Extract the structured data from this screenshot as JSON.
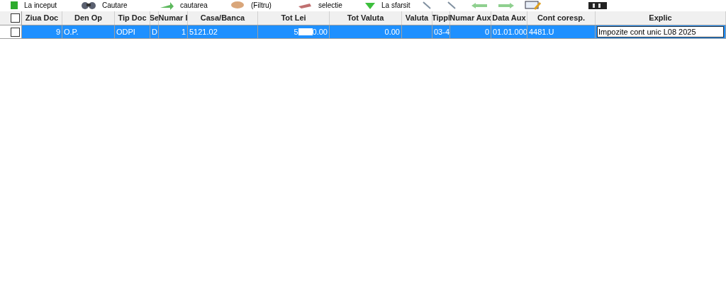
{
  "toolbar": [
    {
      "kind": "first",
      "label": "La inceput"
    },
    {
      "kind": "search",
      "label": "Cautare"
    },
    {
      "kind": "next",
      "label": "cautarea"
    },
    {
      "kind": "filter",
      "label": "(Filtru)"
    },
    {
      "kind": "select",
      "label": "selectie"
    },
    {
      "kind": "last",
      "label": "La sfarsit"
    },
    {
      "kind": "zoom"
    },
    {
      "kind": "zoom"
    },
    {
      "kind": "left"
    },
    {
      "kind": "right"
    },
    {
      "kind": "edit"
    },
    {
      "kind": "print"
    }
  ],
  "table": {
    "columns": [
      "Ziua Doc",
      "Den Op",
      "Tip Doc",
      "Se",
      "Numar I",
      "Casa/Banca",
      "Tot Lei",
      "Tot Valuta",
      "Valuta",
      "Tippl",
      "Numar Aux",
      "Data Aux",
      "Cont coresp.",
      "Explic"
    ],
    "header_checked": false,
    "rows": [
      {
        "selected": true,
        "checked": false,
        "cells": [
          "9",
          "O.P.",
          "ODPI",
          "D",
          "1",
          "5121.02",
          {
            "before": "5",
            "after": "0.00",
            "redacted": true
          },
          "0.00",
          "",
          "03-4",
          "0",
          "01.01.000",
          "4481.U",
          {
            "editing": true,
            "value": "Impozite cont unic L08 2025"
          }
        ]
      }
    ]
  }
}
